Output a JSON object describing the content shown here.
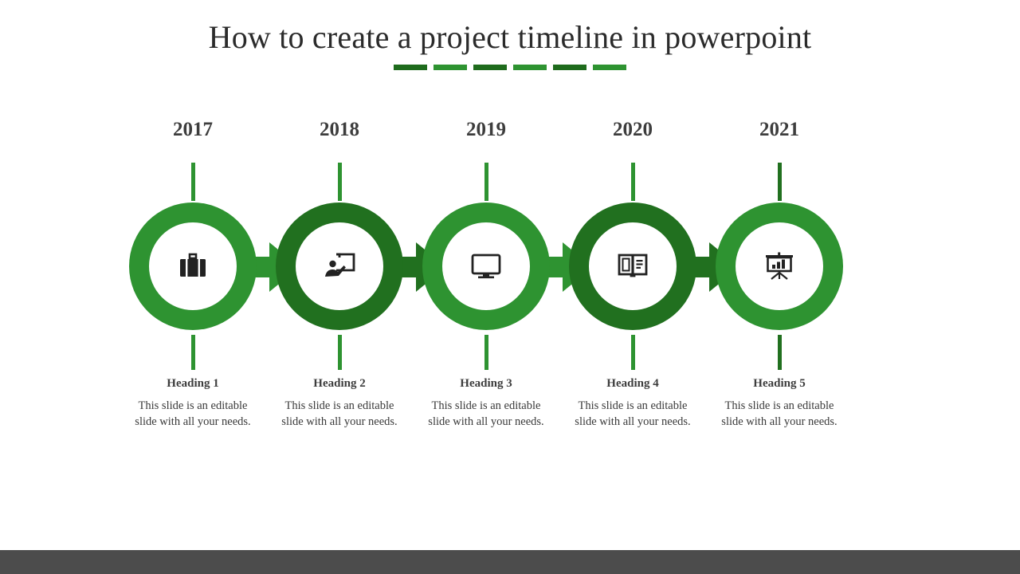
{
  "slide": {
    "title": "How to create a project timeline in powerpoint",
    "background_color": "#ffffff",
    "bottom_bar_color": "#4c4c4c"
  },
  "colors": {
    "green_light": "#2E9331",
    "green_dark": "#21701F",
    "text_dark": "#3d3d3d",
    "title_text": "#2b2b2b"
  },
  "title_dashes": [
    {
      "color": "#1e6b1c"
    },
    {
      "color": "#2E9331"
    },
    {
      "color": "#1e6b1c"
    },
    {
      "color": "#2E9331"
    },
    {
      "color": "#1e6b1c"
    },
    {
      "color": "#2E9331"
    }
  ],
  "milestones": [
    {
      "year": "2017",
      "heading": "Heading 1",
      "body": "This slide is an editable slide with all your needs.",
      "icon": "briefcase-icon",
      "ring_color": "#2E9331",
      "tick_color": "#2E9331"
    },
    {
      "year": "2018",
      "heading": "Heading 2",
      "body": "This slide is an editable slide with all your needs.",
      "icon": "presenter-board-icon",
      "ring_color": "#21701F",
      "tick_color": "#2E9331"
    },
    {
      "year": "2019",
      "heading": "Heading 3",
      "body": "This slide is an editable slide with all your needs.",
      "icon": "monitor-icon",
      "ring_color": "#2E9331",
      "tick_color": "#2E9331"
    },
    {
      "year": "2020",
      "heading": "Heading 4",
      "body": "This slide is an editable slide with all your needs.",
      "icon": "open-book-icon",
      "ring_color": "#21701F",
      "tick_color": "#2E9331"
    },
    {
      "year": "2021",
      "heading": "Heading 5",
      "body": "This slide is an editable slide with all your needs.",
      "icon": "presentation-chart-icon",
      "ring_color": "#2E9331",
      "tick_color": "#21701F"
    }
  ],
  "arrows": [
    {
      "color": "#2E9331"
    },
    {
      "color": "#21701F"
    },
    {
      "color": "#2E9331"
    },
    {
      "color": "#21701F"
    }
  ]
}
